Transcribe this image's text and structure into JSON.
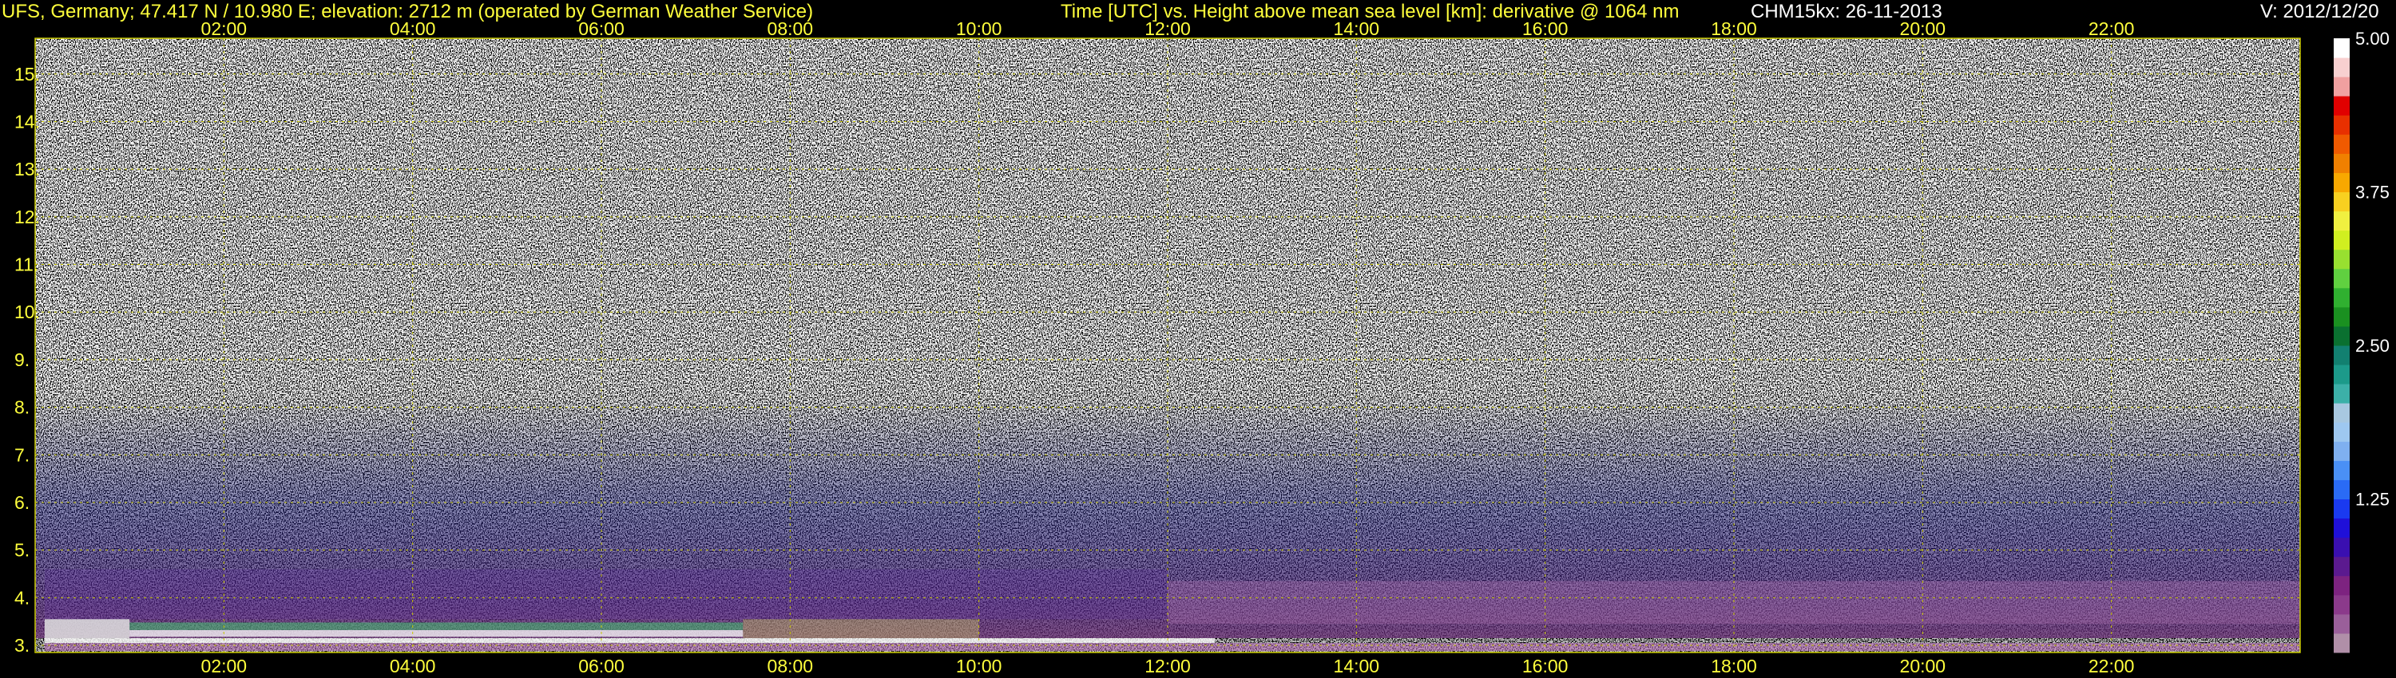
{
  "header": {
    "station": "UFS, Germany; 47.417 N / 10.980 E; elevation: 2712 m  (operated by German Weather Service)",
    "plot_desc": "Time [UTC] vs. Height above mean sea level [km]: derivative @ 1064 nm",
    "instrument_date": "CHM15kx: 26-11-2013",
    "version": "V: 2012/12/20"
  },
  "chart_data": {
    "type": "heatmap",
    "title": "Time [UTC] vs. Height above mean sea level [km]: derivative @ 1064 nm",
    "x_ticks": [
      "02:00",
      "04:00",
      "06:00",
      "08:00",
      "10:00",
      "12:00",
      "14:00",
      "16:00",
      "18:00",
      "20:00",
      "22:00"
    ],
    "x_tick_hours": [
      2,
      4,
      6,
      8,
      10,
      12,
      14,
      16,
      18,
      20,
      22
    ],
    "xlim_hours": [
      0,
      24
    ],
    "y_ticks": [
      "3.",
      "4.",
      "5.",
      "6.",
      "7.",
      "8.",
      "9.",
      "10.",
      "11.",
      "12.",
      "13.",
      "14.",
      "15."
    ],
    "y_tick_values": [
      3,
      4,
      5,
      6,
      7,
      8,
      9,
      10,
      11,
      12,
      13,
      14,
      15
    ],
    "ylim_km": [
      2.85,
      15.75
    ],
    "grid": true,
    "colorbar": {
      "labels": [
        "5.00",
        "3.75",
        "2.50",
        "1.25"
      ],
      "values": [
        5.0,
        3.75,
        2.5,
        1.25
      ],
      "range": [
        0,
        5.0
      ],
      "colors": [
        "#b08fa8",
        "#9a5f9a",
        "#8b3a8b",
        "#7d2380",
        "#5b1a8f",
        "#3a0fb0",
        "#1f10d8",
        "#1a3af0",
        "#2a6bf5",
        "#4a90f5",
        "#7fb0f0",
        "#9ec8f0",
        "#a8c8e0",
        "#3cb0a8",
        "#1c9a8a",
        "#128070",
        "#0a7030",
        "#1a9020",
        "#30b030",
        "#60d040",
        "#98e030",
        "#d0ef20",
        "#f0f040",
        "#f8d020",
        "#f8a800",
        "#f08000",
        "#f05a00",
        "#e83000",
        "#e00000",
        "#f0a0a0",
        "#f8d0d0",
        "#ffffff"
      ]
    }
  },
  "colors": {
    "text": "#ffff3c",
    "grid": "#c8c800",
    "instrument_text": "#ffffff"
  }
}
